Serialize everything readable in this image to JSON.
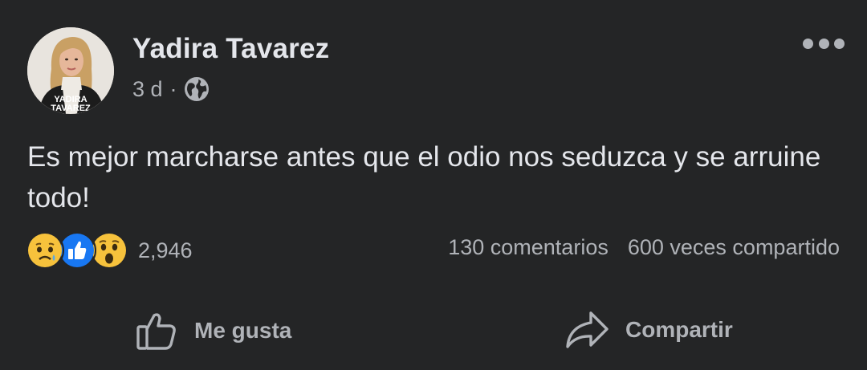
{
  "post": {
    "author": "Yadira Tavarez",
    "avatar_caption_line1": "YADIRA",
    "avatar_caption_line2": "TAVAREZ",
    "time": "3 d",
    "separator": "·",
    "audience_icon": "globe-icon",
    "text": "Es mejor marcharse antes que el odio nos seduzca y se arruine todo!"
  },
  "engagement": {
    "reaction_icons": [
      "sad-reaction-icon",
      "like-reaction-icon",
      "wow-reaction-icon"
    ],
    "reaction_count": "2,946",
    "comments": "130 comentarios",
    "shares": "600 veces compartido"
  },
  "actions": {
    "like_label": "Me gusta",
    "share_label": "Compartir"
  },
  "colors": {
    "background": "#242526",
    "primary_text": "#e4e6eb",
    "secondary_text": "#b0b3b8",
    "like_blue": "#1877f2",
    "reaction_yellow": "#f7c23c"
  }
}
